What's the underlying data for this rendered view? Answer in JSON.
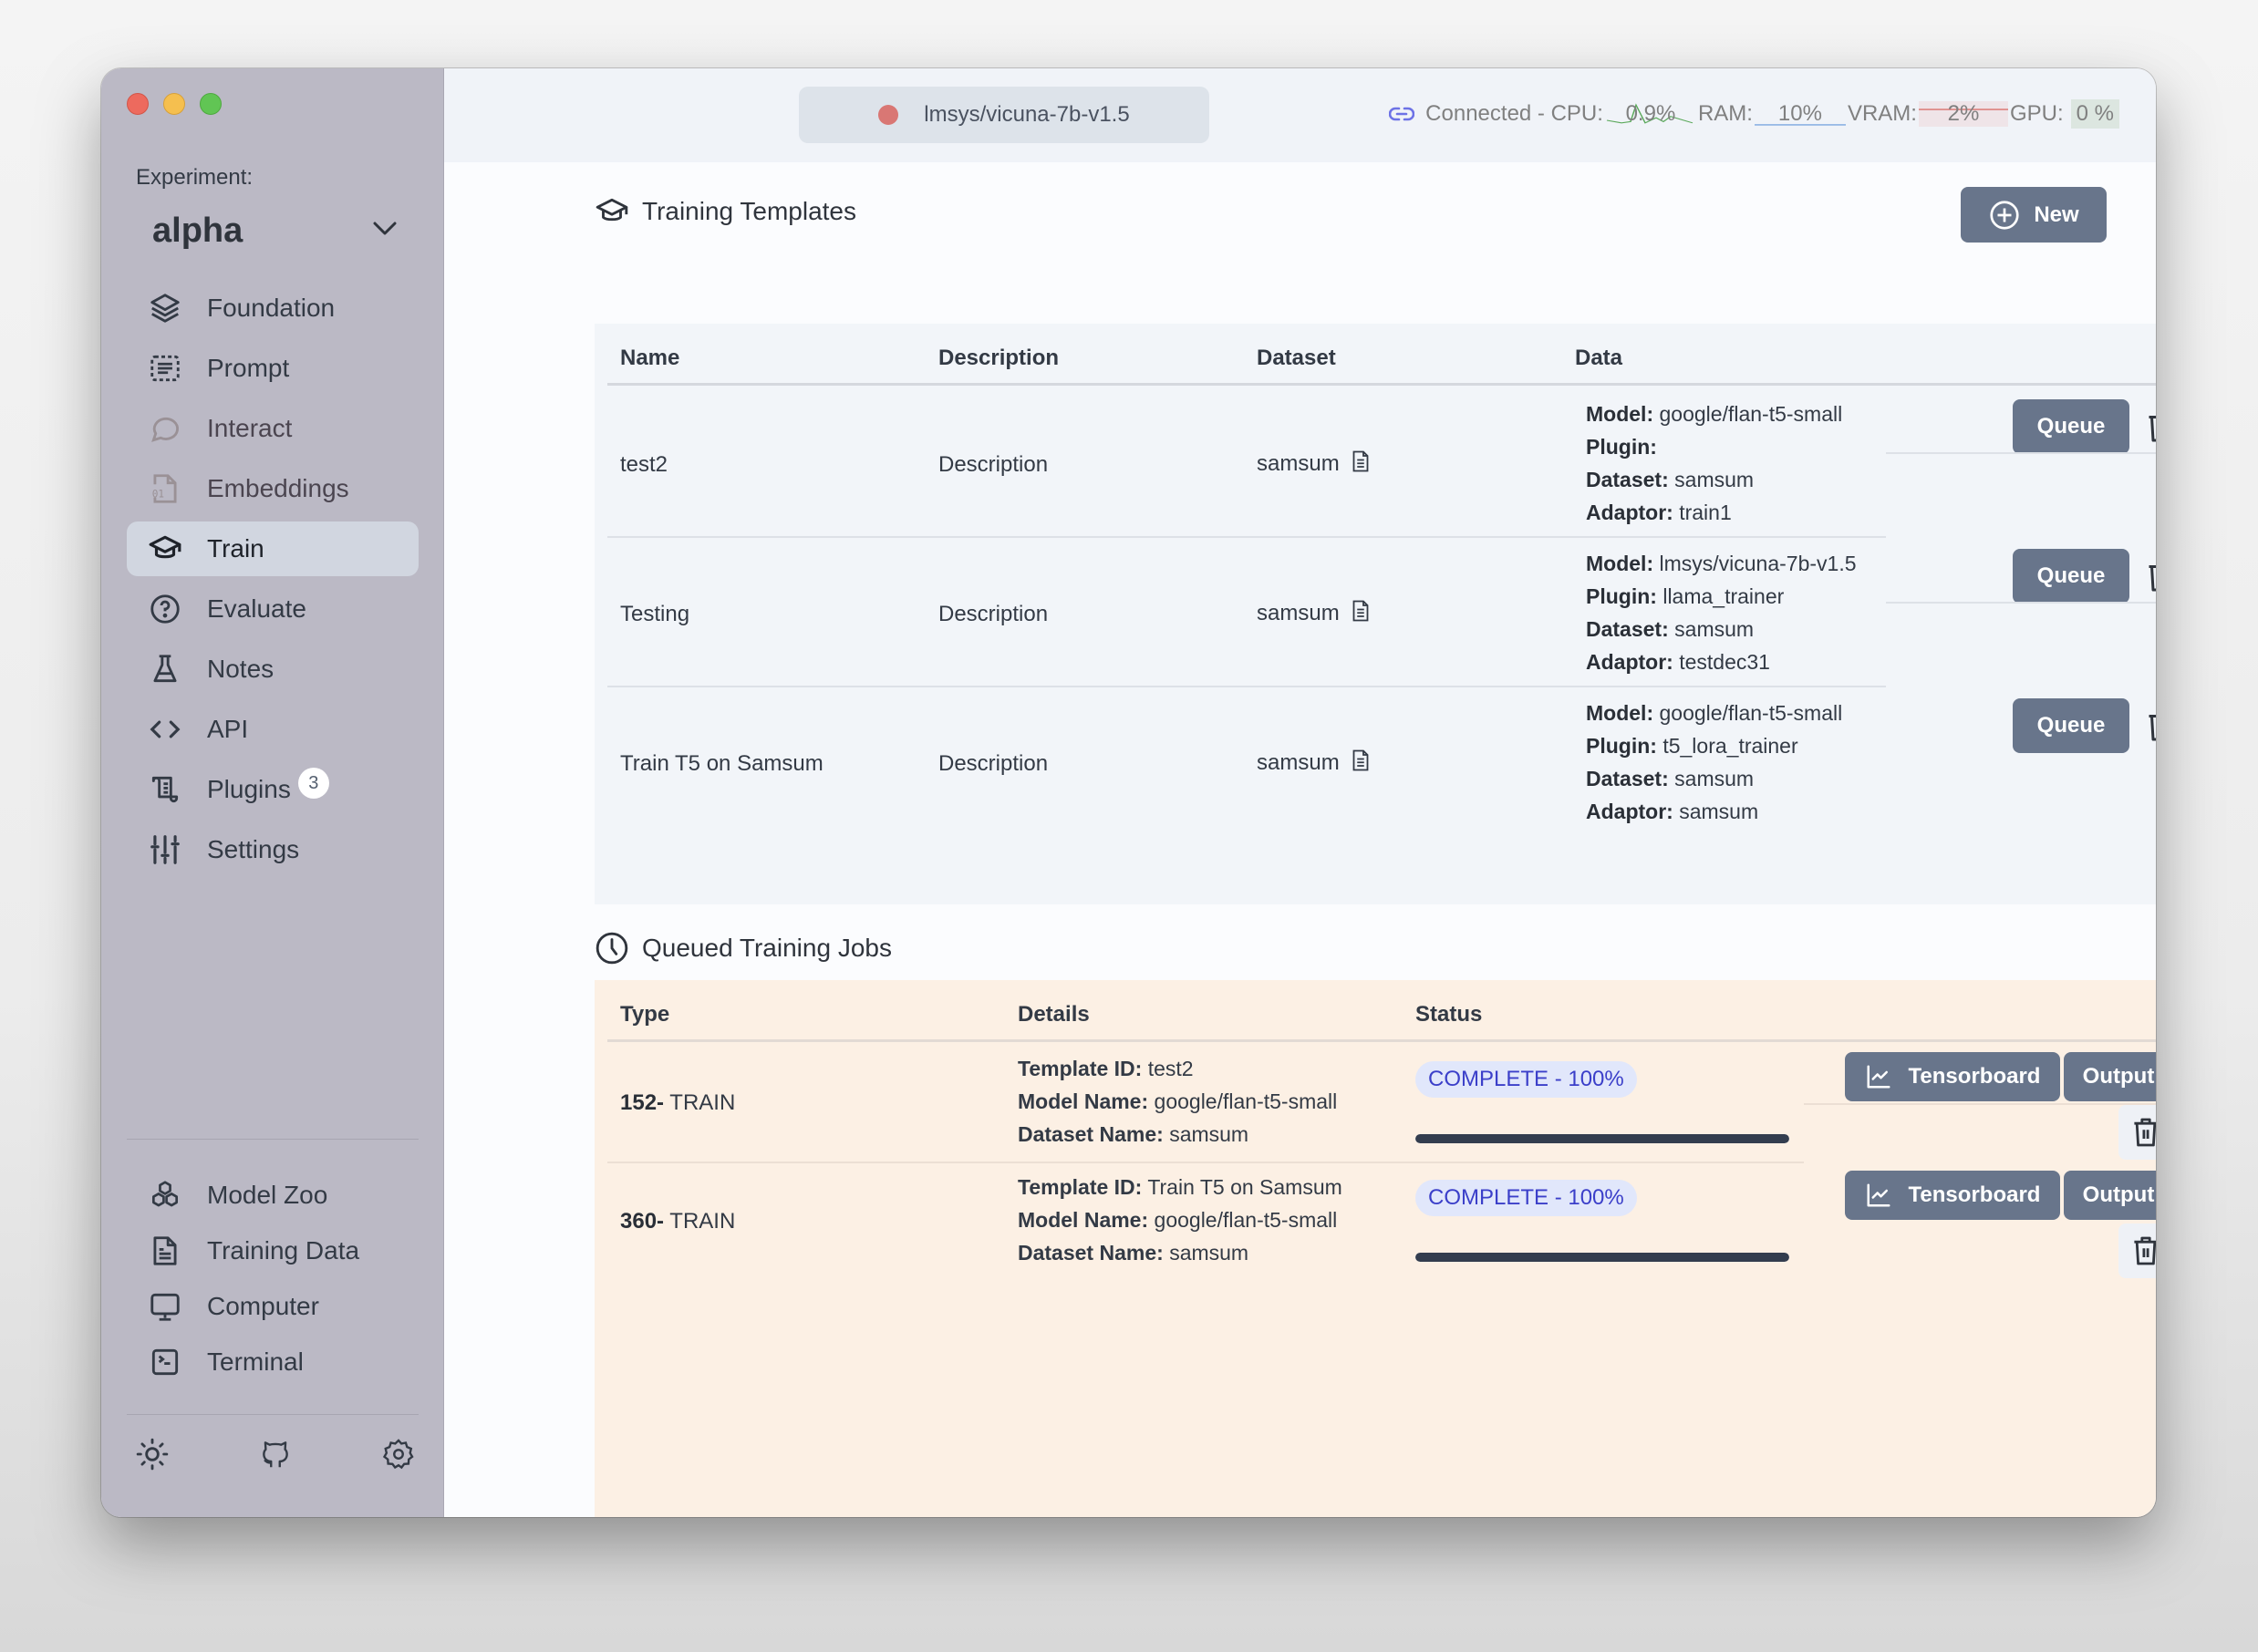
{
  "window": {
    "traffic_lights": [
      "close",
      "minimize",
      "zoom"
    ]
  },
  "sidebar": {
    "experiment_label": "Experiment:",
    "experiment_value": "alpha",
    "items": [
      {
        "label": "Foundation",
        "icon": "layers-icon",
        "active": false
      },
      {
        "label": "Prompt",
        "icon": "prompt-icon",
        "active": false
      },
      {
        "label": "Interact",
        "icon": "chat-bubble-icon",
        "active": false,
        "disabled": true
      },
      {
        "label": "Embeddings",
        "icon": "binary-file-icon",
        "active": false,
        "disabled": true
      },
      {
        "label": "Train",
        "icon": "graduation-cap-icon",
        "active": true
      },
      {
        "label": "Evaluate",
        "icon": "help-circle-icon",
        "active": false
      },
      {
        "label": "Notes",
        "icon": "flask-icon",
        "active": false
      },
      {
        "label": "API",
        "icon": "code-icon",
        "active": false
      },
      {
        "label": "Plugins",
        "icon": "scroll-icon",
        "active": false,
        "badge": "3"
      },
      {
        "label": "Settings",
        "icon": "sliders-icon",
        "active": false
      }
    ],
    "secondary_items": [
      {
        "label": "Model Zoo",
        "icon": "boxes-icon"
      },
      {
        "label": "Training Data",
        "icon": "file-text-icon"
      },
      {
        "label": "Computer",
        "icon": "monitor-icon"
      },
      {
        "label": "Terminal",
        "icon": "terminal-icon"
      }
    ],
    "footer_icons": [
      "sun-icon",
      "github-icon",
      "gear-icon"
    ]
  },
  "header": {
    "model_name": "lmsys/vicuna-7b-v1.5",
    "model_status_color": "#d97774",
    "connection": "Connected - CPU:",
    "cpu_value": "0.9%",
    "ram_label": "RAM:",
    "ram_value": "10%",
    "vram_label": "VRAM:",
    "vram_value": "2%",
    "gpu_label": "GPU:",
    "gpu_value": "0 %"
  },
  "templates": {
    "title": "Training Templates",
    "new_label": "New",
    "columns": [
      "Name",
      "Description",
      "Dataset",
      "Data"
    ],
    "queue_label": "Queue",
    "rows": [
      {
        "name": "test2",
        "description": "Description",
        "dataset": "samsum",
        "model_label": "Model:",
        "model": "google/flan-t5-small",
        "plugin_label": "Plugin:",
        "plugin": "",
        "dataset_label": "Dataset:",
        "dataset_value": "samsum",
        "adaptor_label": "Adaptor:",
        "adaptor": "train1"
      },
      {
        "name": "Testing",
        "description": "Description",
        "dataset": "samsum",
        "model_label": "Model:",
        "model": "lmsys/vicuna-7b-v1.5",
        "plugin_label": "Plugin:",
        "plugin": "llama_trainer",
        "dataset_label": "Dataset:",
        "dataset_value": "samsum",
        "adaptor_label": "Adaptor:",
        "adaptor": "testdec31"
      },
      {
        "name": "Train T5 on Samsum",
        "description": "Description",
        "dataset": "samsum",
        "model_label": "Model:",
        "model": "google/flan-t5-small",
        "plugin_label": "Plugin:",
        "plugin": "t5_lora_trainer",
        "dataset_label": "Dataset:",
        "dataset_value": "samsum",
        "adaptor_label": "Adaptor:",
        "adaptor": "samsum"
      }
    ]
  },
  "jobs": {
    "title": "Queued Training Jobs",
    "columns": [
      "Type",
      "Details",
      "Status"
    ],
    "tensorboard_label": "Tensorboard",
    "output_label": "Output",
    "rows": [
      {
        "id": "152-",
        "type": "TRAIN",
        "template_label": "Template ID:",
        "template": "test2",
        "model_label": "Model Name:",
        "model": "google/flan-t5-small",
        "dataset_label": "Dataset Name:",
        "dataset": "samsum",
        "status": "COMPLETE - 100%",
        "progress": 100
      },
      {
        "id": "360-",
        "type": "TRAIN",
        "template_label": "Template ID:",
        "template": "Train T5 on Samsum",
        "model_label": "Model Name:",
        "model": "google/flan-t5-small",
        "dataset_label": "Dataset Name:",
        "dataset": "samsum",
        "status": "COMPLETE - 100%",
        "progress": 100
      }
    ]
  },
  "colors": {
    "sidebar_bg": "#bbb9c5",
    "button_bg": "#68758b",
    "templates_bg": "#f2f5f9",
    "jobs_bg": "#fcf0e4",
    "status_pill_bg": "#e1e7fb",
    "status_pill_text": "#3b3fc9",
    "cpu_spark": "#5aa85a",
    "ram_spark": "#7aa6e0",
    "vram_spark": "#d9706c"
  }
}
